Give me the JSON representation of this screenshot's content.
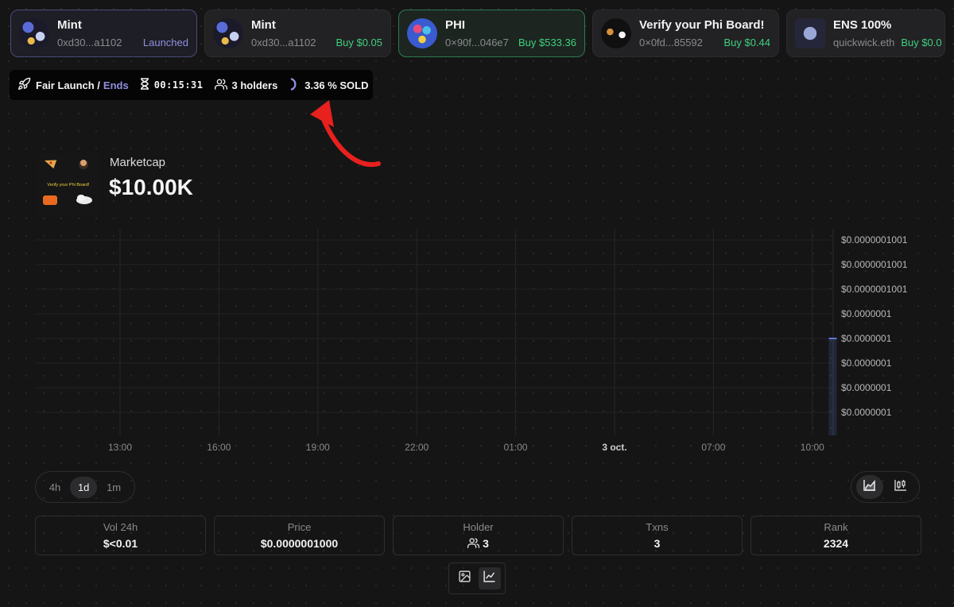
{
  "cards": [
    {
      "title": "Mint",
      "address": "0xd30...a1102",
      "status": "Launched",
      "kind": "status"
    },
    {
      "title": "Mint",
      "address": "0xd30...a1102",
      "status": "Buy $0.05",
      "kind": "buy"
    },
    {
      "title": "PHI",
      "address": "0×90f...046e7",
      "status": "Buy $533.36",
      "kind": "buy"
    },
    {
      "title": "Verify your Phi Board!",
      "address": "0×0fd...85592",
      "status": "Buy $0.44",
      "kind": "buy"
    },
    {
      "title": "ENS 100%",
      "address": "quickwick.eth",
      "status": "Buy $0.0",
      "kind": "buy"
    }
  ],
  "status_bar": {
    "launch_label": "Fair Launch /",
    "ends_label": "Ends",
    "timer": "00:15:31",
    "holders": "3 holders",
    "sold": "3.36 % SOLD",
    "sold_fraction": 0.0336
  },
  "token_image": {
    "caption": "Verify your Phi Board!"
  },
  "marketcap": {
    "label": "Marketcap",
    "value": "$10.00K"
  },
  "chart_data": {
    "type": "bar",
    "x_ticks": [
      "13:00",
      "16:00",
      "19:00",
      "22:00",
      "01:00",
      "3 oct.",
      "07:00",
      "10:00"
    ],
    "y_ticks": [
      "$0.0000001001",
      "$0.0000001001",
      "$0.0000001001",
      "$0.0000001",
      "$0.0000001",
      "$0.0000001",
      "$0.0000001",
      "$0.0000001"
    ],
    "bars": [
      {
        "x": "10:30",
        "value": 1e-07
      }
    ],
    "grid": true
  },
  "timeframes": [
    "4h",
    "1d",
    "1m"
  ],
  "active_timeframe": "1d",
  "stats": [
    {
      "label": "Vol 24h",
      "value": "$<0.01"
    },
    {
      "label": "Price",
      "value": "$0.0000001000"
    },
    {
      "label": "Holder",
      "value": "3"
    },
    {
      "label": "Txns",
      "value": "3"
    },
    {
      "label": "Rank",
      "value": "2324"
    }
  ],
  "colors": {
    "accent": "#8f8fe0",
    "buy": "#3fcf7e",
    "arrow": "#e8201e",
    "bar": "#5a78d8"
  }
}
